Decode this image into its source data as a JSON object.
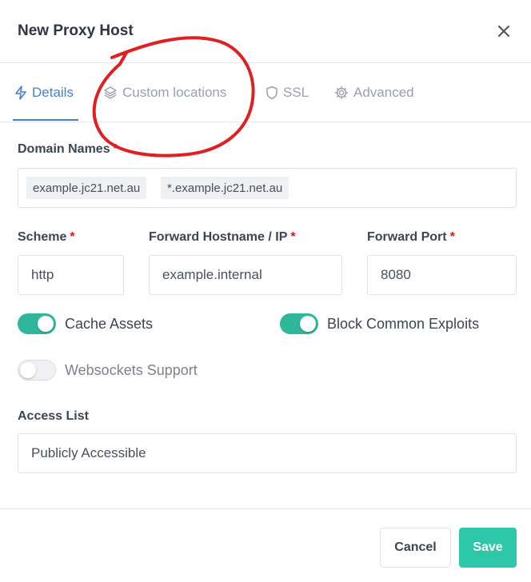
{
  "dialog": {
    "title": "New Proxy Host",
    "close_icon": "close-icon"
  },
  "tabs": [
    {
      "label": "Details",
      "icon": "bolt-icon",
      "active": true
    },
    {
      "label": "Custom locations",
      "icon": "layers-icon",
      "active": false
    },
    {
      "label": "SSL",
      "icon": "shield-icon",
      "active": false
    },
    {
      "label": "Advanced",
      "icon": "gear-icon",
      "active": false
    }
  ],
  "domain_names": {
    "label": "Domain Names",
    "required_mark": "*",
    "values": [
      "example.jc21.net.au",
      "*.example.jc21.net.au"
    ]
  },
  "scheme": {
    "label": "Scheme",
    "required_mark": "*",
    "value": "http"
  },
  "forward_hostname": {
    "label": "Forward Hostname / IP",
    "required_mark": "*",
    "value": "example.internal"
  },
  "forward_port": {
    "label": "Forward Port",
    "required_mark": "*",
    "value": "8080"
  },
  "toggles": {
    "cache_assets": {
      "label": "Cache Assets",
      "on": true
    },
    "block_exploits": {
      "label": "Block Common Exploits",
      "on": true
    },
    "websockets": {
      "label": "Websockets Support",
      "on": false
    }
  },
  "access_list": {
    "label": "Access List",
    "value": "Publicly Accessible"
  },
  "footer": {
    "cancel_label": "Cancel",
    "save_label": "Save"
  },
  "colors": {
    "accent": "#467fcf",
    "toggle_on": "#2fb79b",
    "save": "#2fc7a9",
    "required": "#cd201f",
    "annotation": "#e02020"
  }
}
